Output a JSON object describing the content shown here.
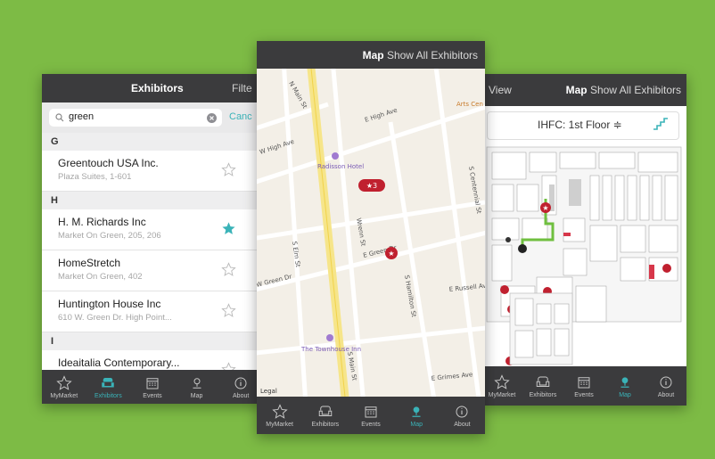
{
  "exhibitors_screen": {
    "title": "Exhibitors",
    "filter_label": "Filte",
    "search_value": "green",
    "cancel_label": "Canc",
    "sections": [
      {
        "letter": "G",
        "rows": [
          {
            "name": "Greentouch USA Inc.",
            "sub": "Plaza Suites, 1-601",
            "starred": false
          }
        ]
      },
      {
        "letter": "H",
        "rows": [
          {
            "name": "H. M. Richards Inc",
            "sub": "Market On Green, 205, 206",
            "starred": true
          },
          {
            "name": "HomeStretch",
            "sub": "Market On Green, 402",
            "starred": false
          },
          {
            "name": "Huntington House Inc",
            "sub": "610 W. Green Dr. High Point...",
            "starred": false
          }
        ]
      },
      {
        "letter": "I",
        "rows": [
          {
            "name": "Ideaitalia Contemporary...",
            "sub": "",
            "starred": false
          }
        ]
      }
    ],
    "tabs": [
      "MyMarket",
      "Exhibitors",
      "Events",
      "Map",
      "About"
    ],
    "active_tab": "Exhibitors"
  },
  "map_screen": {
    "seg_active": "Map",
    "seg_other": "Show All Exhibitors",
    "streets": [
      "E High Ave",
      "W High Ave",
      "N Main St",
      "E Green Dr",
      "W Green Dr",
      "S Main St",
      "E Grimes Ave",
      "S Hamilton St",
      "S Centennial St",
      "Wrenn St",
      "S Elm St",
      "E Russell Ave",
      "Arts Cen"
    ],
    "poi": [
      "Radisson Hotel",
      "The Townhouse Inn"
    ],
    "cluster_label": "★3",
    "legal": "Legal",
    "tabs": [
      "MyMarket",
      "Exhibitors",
      "Events",
      "Map",
      "About"
    ],
    "active_tab": "Map"
  },
  "floor_screen": {
    "view_label": "View",
    "seg_active": "Map",
    "seg_other": "Show All Exhibitors",
    "floor_title": "IHFC: 1st Floor ≑",
    "tabs": [
      "MyMarket",
      "Exhibitors",
      "Events",
      "Map",
      "About"
    ],
    "active_tab": "Map"
  },
  "colors": {
    "background": "#7dbb45",
    "bar": "#3b3b3d",
    "accent": "#3ab3b8",
    "pin": "#c0202f"
  }
}
